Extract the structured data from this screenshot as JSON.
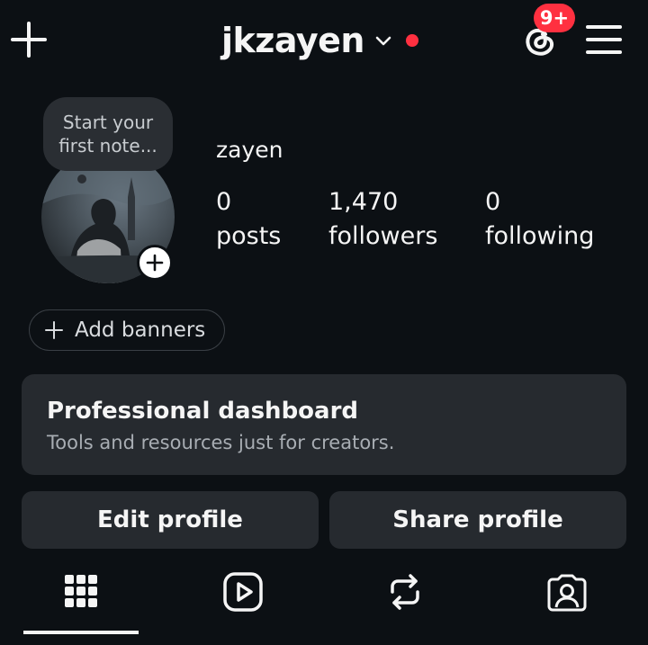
{
  "header": {
    "username": "jkzayen",
    "notification_badge": "9+",
    "icons": {
      "create": "plus-icon",
      "account_switch": "chevron-down-icon",
      "threads": "threads-icon",
      "menu": "hamburger-menu-icon"
    },
    "colors": {
      "badge": "#ff3040",
      "background": "#0c1014"
    }
  },
  "profile": {
    "note_line1": "Start your",
    "note_line2": "first note...",
    "display_name": "zayen",
    "stats": [
      {
        "value": "0",
        "label": "posts"
      },
      {
        "value": "1,470",
        "label": "followers"
      },
      {
        "value": "0",
        "label": "following"
      }
    ]
  },
  "banners": {
    "label": "Add banners"
  },
  "dashboard": {
    "title": "Professional dashboard",
    "subtitle": "Tools and resources just for creators."
  },
  "actions": {
    "edit_label": "Edit profile",
    "share_label": "Share profile"
  },
  "tabs": [
    {
      "name": "grid",
      "icon": "grid-icon",
      "selected": true
    },
    {
      "name": "reels",
      "icon": "reels-icon",
      "selected": false
    },
    {
      "name": "reposts",
      "icon": "repost-icon",
      "selected": false
    },
    {
      "name": "tagged",
      "icon": "tagged-icon",
      "selected": false
    }
  ]
}
